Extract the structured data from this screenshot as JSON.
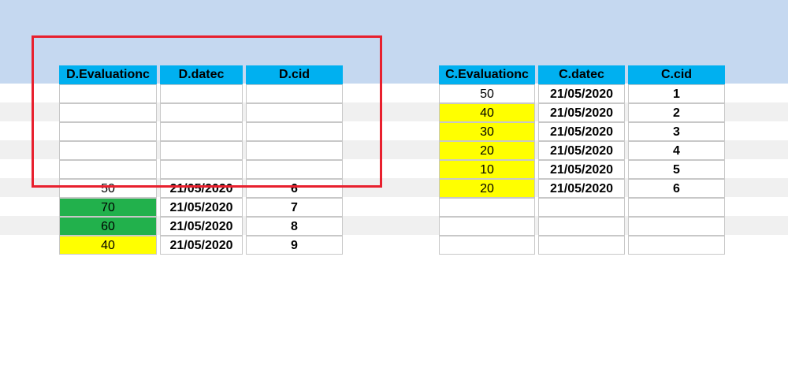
{
  "colors": {
    "header_bg": "#00b0f0",
    "yellow": "#ffff00",
    "green": "#22b14c",
    "selection_border": "#e8202e",
    "top_band": "#c5d8f0"
  },
  "table_d": {
    "headers": [
      "D.Evaluationc",
      "D.datec",
      "D.cid"
    ],
    "rows": [
      [
        "",
        "",
        ""
      ],
      [
        "",
        "",
        ""
      ],
      [
        "",
        "",
        ""
      ],
      [
        "",
        "",
        ""
      ],
      [
        "",
        "",
        ""
      ],
      [
        "50",
        "21/05/2020",
        "6"
      ],
      [
        "70",
        "21/05/2020",
        "7"
      ],
      [
        "60",
        "21/05/2020",
        "8"
      ],
      [
        "40",
        "21/05/2020",
        "9"
      ]
    ],
    "fills": [
      "",
      "",
      "",
      "",
      "",
      "",
      "green",
      "green",
      "yellow"
    ]
  },
  "table_c": {
    "headers": [
      "C.Evaluationc",
      "C.datec",
      "C.cid"
    ],
    "rows": [
      [
        "50",
        "21/05/2020",
        "1"
      ],
      [
        "40",
        "21/05/2020",
        "2"
      ],
      [
        "30",
        "21/05/2020",
        "3"
      ],
      [
        "20",
        "21/05/2020",
        "4"
      ],
      [
        "10",
        "21/05/2020",
        "5"
      ],
      [
        "20",
        "21/05/2020",
        "6"
      ],
      [
        "",
        "",
        ""
      ],
      [
        "",
        "",
        ""
      ],
      [
        "",
        "",
        ""
      ]
    ],
    "fills": [
      "",
      "yellow",
      "yellow",
      "yellow",
      "yellow",
      "yellow",
      "",
      "",
      ""
    ]
  }
}
